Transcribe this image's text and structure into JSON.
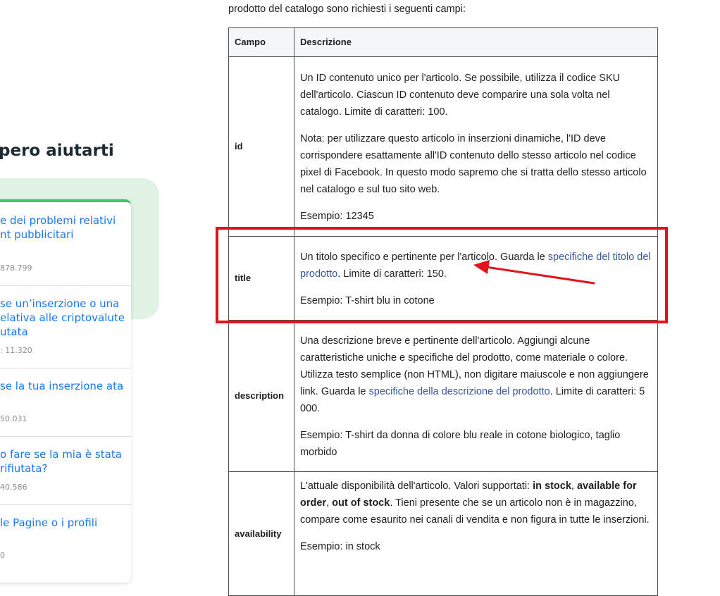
{
  "sidebar": {
    "heading": "pero aiutarti",
    "articles": [
      {
        "title": "e dei problemi relativi nt pubblicitari",
        "views": "878.799"
      },
      {
        "title": "se un’inserzione o una elativa alle criptovalute utata",
        "views": ": 11.320"
      },
      {
        "title": "se la tua inserzione ata",
        "views": "50.031"
      },
      {
        "title": "o fare se la mia è stata rifiutata?",
        "views": "40.586"
      },
      {
        "title": "le Pagine o i profili",
        "views": "0"
      }
    ]
  },
  "main": {
    "intro": "prodotto del catalogo sono richiesti i seguenti campi:",
    "table": {
      "headers": {
        "field": "Campo",
        "description": "Descrizione"
      },
      "rows": [
        {
          "field": "id",
          "p1": "Un ID contenuto unico per l'articolo. Se possibile, utilizza il codice SKU dell'articolo. Ciascun ID contenuto deve comparire una sola volta nel catalogo. Limite di caratteri: 100.",
          "p2": "Nota: per utilizzare questo articolo in inserzioni dinamiche, l'ID deve corrispondere esattamente all'ID contenuto dello stesso articolo nel codice pixel di Facebook. In questo modo sapremo che si tratta dello stesso articolo nel catalogo e sul tuo sito web.",
          "example": "Esempio: 12345"
        },
        {
          "field": "title",
          "p1_before": "Un titolo specifico e pertinente per l'articolo. Guarda le ",
          "p1_link": "specifiche del titolo del prodotto",
          "p1_after": ". Limite di caratteri: 150.",
          "example": "Esempio: T-shirt blu in cotone"
        },
        {
          "field": "description",
          "p1_before": "Una descrizione breve e pertinente dell'articolo. Aggiungi alcune caratteristiche uniche e specifiche del prodotto, come materiale o colore. Utilizza testo semplice (non HTML), non digitare maiuscole e non aggiungere link. Guarda le ",
          "p1_link": "specifiche della descrizione del prodotto",
          "p1_after": ". Limite di caratteri: 5 000.",
          "example": "Esempio: T-shirt da donna di colore blu reale in cotone biologico, taglio morbido"
        },
        {
          "field": "availability",
          "p1_a": "L'attuale disponibilità dell'articolo. Valori supportati: ",
          "p1_b1": "in stock",
          "p1_c": ", ",
          "p1_b2": "available for order",
          "p1_d": ", ",
          "p1_b3": "out of stock",
          "p1_e": ". Tieni presente che se un articolo non è in magazzino, compare come esaurito nei canali di vendita e non figura in tutte le inserzioni.",
          "example": "Esempio: in stock"
        }
      ]
    }
  },
  "annotation": {
    "color": "#e1141b"
  }
}
